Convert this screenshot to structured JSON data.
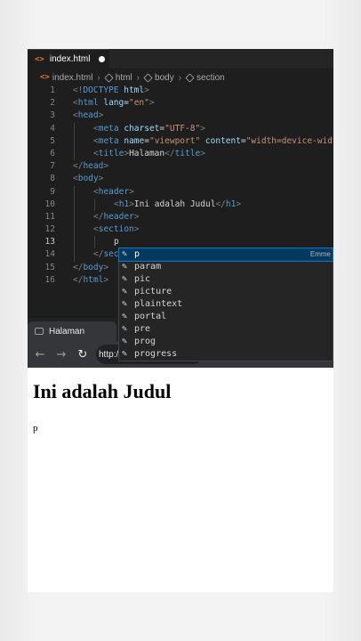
{
  "editor": {
    "tab": {
      "icon": "<>",
      "filename": "index.html"
    },
    "breadcrumb": [
      "index.html",
      "html",
      "body",
      "section"
    ],
    "lines": [
      {
        "n": "1",
        "indent": 0,
        "parts": [
          [
            "p",
            "<!"
          ],
          [
            "t",
            "DOCTYPE"
          ],
          [
            "w",
            " "
          ],
          [
            "a",
            "html"
          ],
          [
            "p",
            ">"
          ]
        ]
      },
      {
        "n": "2",
        "indent": 0,
        "parts": [
          [
            "p",
            "<"
          ],
          [
            "t",
            "html"
          ],
          [
            "w",
            " "
          ],
          [
            "a",
            "lang"
          ],
          [
            "w",
            "="
          ],
          [
            "s",
            "\"en\""
          ],
          [
            "p",
            ">"
          ]
        ]
      },
      {
        "n": "3",
        "indent": 0,
        "parts": [
          [
            "p",
            "<"
          ],
          [
            "t",
            "head"
          ],
          [
            "p",
            ">"
          ]
        ]
      },
      {
        "n": "4",
        "indent": 1,
        "parts": [
          [
            "p",
            "<"
          ],
          [
            "t",
            "meta"
          ],
          [
            "w",
            " "
          ],
          [
            "a",
            "charset"
          ],
          [
            "w",
            "="
          ],
          [
            "s",
            "\"UTF-8\""
          ],
          [
            "p",
            ">"
          ]
        ]
      },
      {
        "n": "5",
        "indent": 1,
        "parts": [
          [
            "p",
            "<"
          ],
          [
            "t",
            "meta"
          ],
          [
            "w",
            " "
          ],
          [
            "a",
            "name"
          ],
          [
            "w",
            "="
          ],
          [
            "s",
            "\"viewport\""
          ],
          [
            "w",
            " "
          ],
          [
            "a",
            "content"
          ],
          [
            "w",
            "="
          ],
          [
            "s",
            "\"width=device-widt"
          ]
        ]
      },
      {
        "n": "6",
        "indent": 1,
        "parts": [
          [
            "p",
            "<"
          ],
          [
            "t",
            "title"
          ],
          [
            "p",
            ">"
          ],
          [
            "w",
            "Halaman"
          ],
          [
            "p",
            "</"
          ],
          [
            "t",
            "title"
          ],
          [
            "p",
            ">"
          ]
        ]
      },
      {
        "n": "7",
        "indent": 0,
        "parts": [
          [
            "p",
            "</"
          ],
          [
            "t",
            "head"
          ],
          [
            "p",
            ">"
          ]
        ]
      },
      {
        "n": "8",
        "indent": 0,
        "parts": [
          [
            "p",
            "<"
          ],
          [
            "t",
            "body"
          ],
          [
            "p",
            ">"
          ]
        ]
      },
      {
        "n": "9",
        "indent": 1,
        "parts": [
          [
            "p",
            "<"
          ],
          [
            "t",
            "header"
          ],
          [
            "p",
            ">"
          ]
        ]
      },
      {
        "n": "10",
        "indent": 2,
        "parts": [
          [
            "p",
            "<"
          ],
          [
            "t",
            "h1"
          ],
          [
            "p",
            ">"
          ],
          [
            "w",
            "Ini adalah Judul"
          ],
          [
            "p",
            "</"
          ],
          [
            "t",
            "h1"
          ],
          [
            "p",
            ">"
          ]
        ]
      },
      {
        "n": "11",
        "indent": 1,
        "parts": [
          [
            "p",
            "</"
          ],
          [
            "t",
            "header"
          ],
          [
            "p",
            ">"
          ]
        ]
      },
      {
        "n": "12",
        "indent": 1,
        "parts": [
          [
            "p",
            "<"
          ],
          [
            "t",
            "section"
          ],
          [
            "p",
            ">"
          ]
        ]
      },
      {
        "n": "13",
        "indent": 2,
        "parts": [
          [
            "w",
            "p"
          ]
        ],
        "active": true
      },
      {
        "n": "14",
        "indent": 1,
        "parts": [
          [
            "p",
            "</"
          ],
          [
            "t",
            "sec"
          ]
        ]
      },
      {
        "n": "15",
        "indent": 0,
        "parts": [
          [
            "p",
            "</"
          ],
          [
            "t",
            "body"
          ],
          [
            "p",
            ">"
          ]
        ]
      },
      {
        "n": "16",
        "indent": 0,
        "parts": [
          [
            "p",
            "</"
          ],
          [
            "t",
            "html"
          ],
          [
            "p",
            ">"
          ]
        ]
      }
    ],
    "suggestions": [
      {
        "label": "p",
        "detail": "Emme",
        "selected": true
      },
      {
        "label": "param"
      },
      {
        "label": "pic"
      },
      {
        "label": "picture"
      },
      {
        "label": "plaintext"
      },
      {
        "label": "portal"
      },
      {
        "label": "pre"
      },
      {
        "label": "prog"
      },
      {
        "label": "progress"
      }
    ]
  },
  "browser": {
    "tab_title": "Halaman",
    "url_text": "http:/",
    "back_icon": "arrow-left-icon",
    "forward_icon": "arrow-right-icon",
    "reload_icon": "reload-icon"
  },
  "preview": {
    "heading": "Ini adalah Judul",
    "paragraph": "p"
  },
  "colors": {
    "editor_bg": "#1e1e1e",
    "tag": "#569cd6",
    "attr": "#9cdcfe",
    "string": "#ce9178",
    "suggest_selected": "#04395e"
  }
}
